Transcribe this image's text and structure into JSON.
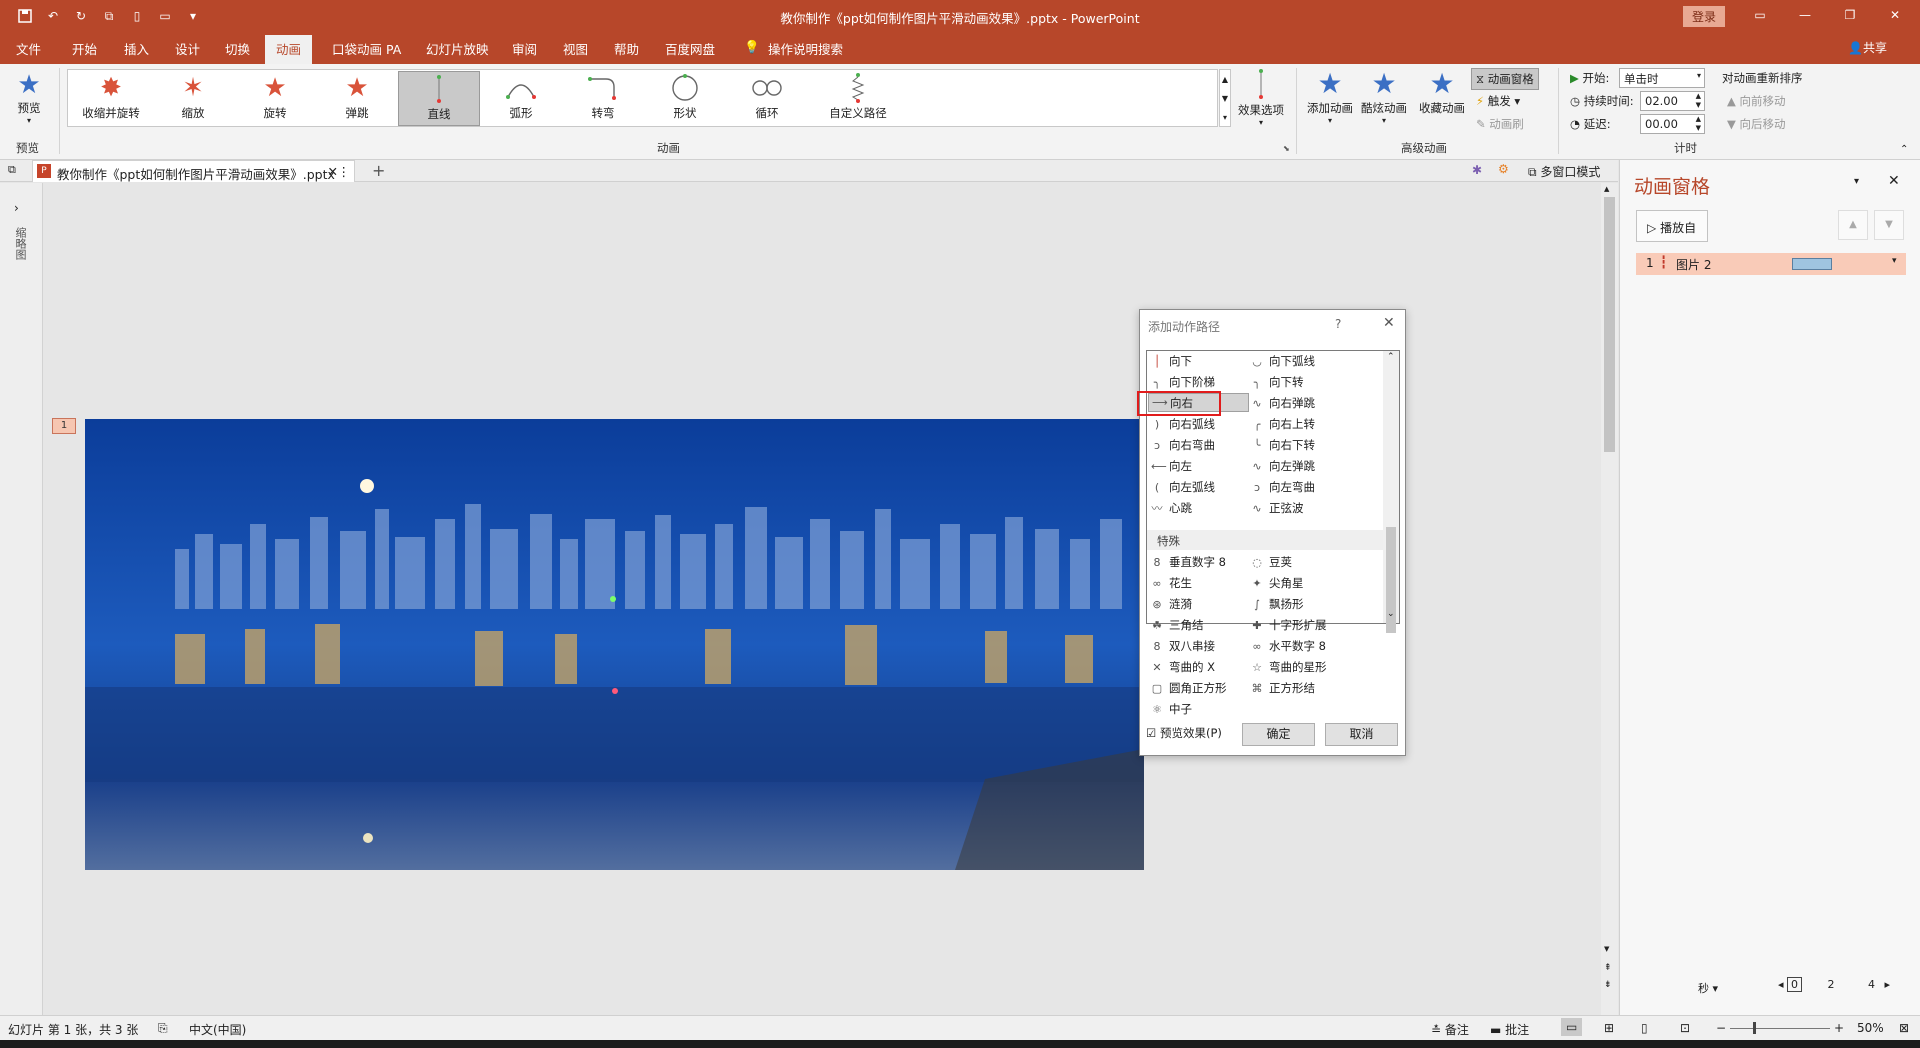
{
  "window": {
    "title": "教你制作《ppt如何制作图片平滑动画效果》.pptx  -  PowerPoint",
    "login": "登录",
    "share": "共享"
  },
  "tabs": [
    "文件",
    "开始",
    "插入",
    "设计",
    "切换",
    "动画",
    "口袋动画 PA",
    "幻灯片放映",
    "审阅",
    "视图",
    "帮助",
    "百度网盘",
    "操作说明搜索"
  ],
  "ribbon": {
    "preview": {
      "label": "预览",
      "group": "预览"
    },
    "gallery": [
      "收缩并旋转",
      "缩放",
      "旋转",
      "弹跳",
      "直线",
      "弧形",
      "转弯",
      "形状",
      "循环",
      "自定义路径"
    ],
    "effect_options": "效果选项",
    "group_animation": "动画",
    "add_animation": "添加动画",
    "cool_animation": "酷炫动画",
    "fav_animation": "收藏动画",
    "anim_pane": "动画窗格",
    "trigger": "触发",
    "anim_painter": "动画刷",
    "group_advanced": "高级动画",
    "start_label": "开始:",
    "start_value": "单击时",
    "duration_label": "持续时间:",
    "duration_value": "02.00",
    "delay_label": "延迟:",
    "delay_value": "00.00",
    "reorder": "对动画重新排序",
    "move_earlier": "向前移动",
    "move_later": "向后移动",
    "group_timing": "计时"
  },
  "doc": {
    "tab": "教你制作《ppt如何制作图片平滑动画效果》.pptx",
    "multiwindow": "多窗口模式",
    "slide_num": "1",
    "thumbs_label": "缩略图"
  },
  "dialog": {
    "title": "添加动作路径",
    "help": "?",
    "left_items": [
      "向下",
      "向下阶梯",
      "向右",
      "向右弧线",
      "向右弯曲",
      "向左",
      "向左弧线",
      "心跳"
    ],
    "right_items": [
      "向下弧线",
      "向下转",
      "向右弹跳",
      "向右上转",
      "向右下转",
      "向左弹跳",
      "向左弯曲",
      "正弦波"
    ],
    "section": "特殊",
    "left_special": [
      "垂直数字 8",
      "花生",
      "涟漪",
      "三角结",
      "双八串接",
      "弯曲的 X",
      "圆角正方形",
      "中子"
    ],
    "right_special": [
      "豆荚",
      "尖角星",
      "飘扬形",
      "十字形扩展",
      "水平数字 8",
      "弯曲的星形",
      "正方形结"
    ],
    "preview_cb": "预览效果(P)",
    "ok": "确定",
    "cancel": "取消"
  },
  "pane": {
    "title": "动画窗格",
    "play": "播放自",
    "row_index": "1",
    "row_name": "图片 2",
    "unit": "秒",
    "ruler": [
      "0",
      "2",
      "4"
    ]
  },
  "status": {
    "slide": "幻灯片 第 1 张，共 3 张",
    "lang": "中文(中国)",
    "notes": "备注",
    "comments": "批注",
    "zoom": "50%"
  }
}
